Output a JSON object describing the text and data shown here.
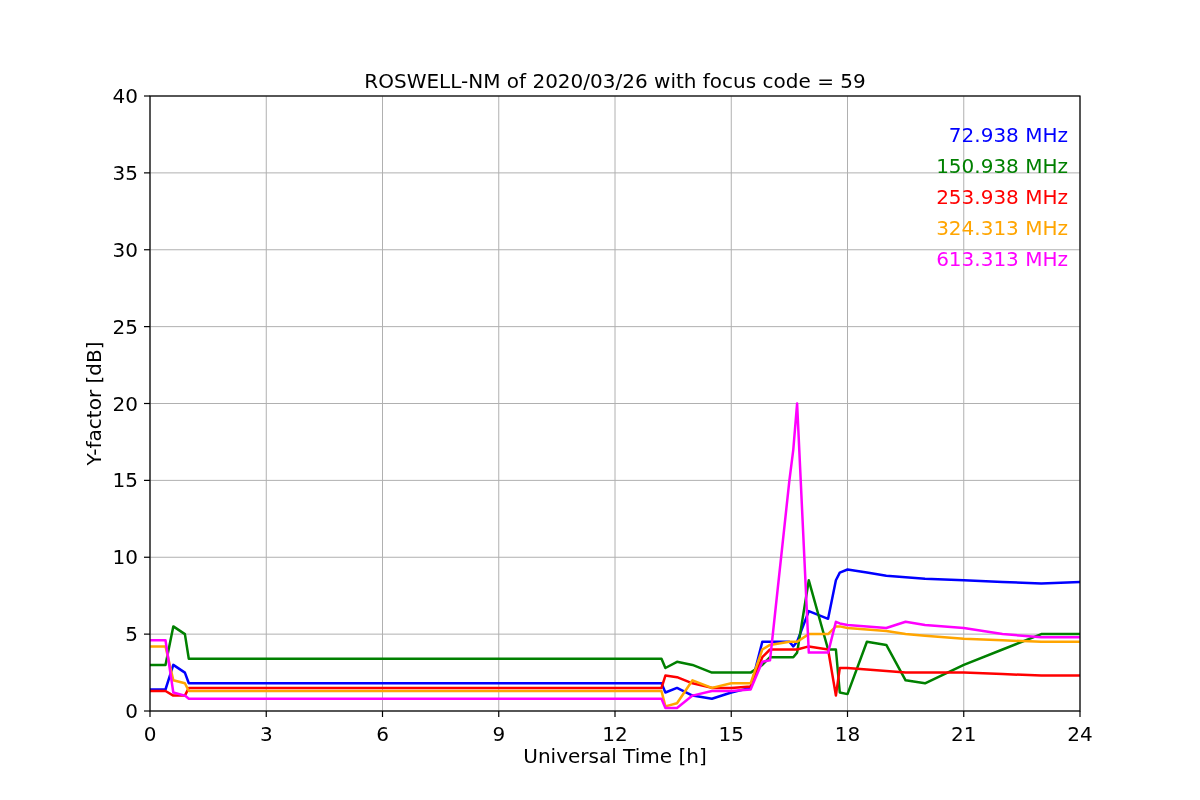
{
  "figure": {
    "chart_data": {
      "type": "line",
      "title": "ROSWELL-NM of 2020/03/26 with focus code = 59",
      "xlabel": "Universal Time [h]",
      "ylabel": "Y-factor [dB]",
      "x": [
        0,
        0.4,
        0.6,
        0.9,
        1.0,
        13.2,
        13.3,
        13.6,
        14,
        14.5,
        15,
        15.5,
        15.8,
        16,
        16.5,
        16.6,
        16.7,
        17,
        17.5,
        17.7,
        17.8,
        18,
        18.5,
        19,
        19.5,
        20,
        21,
        22,
        23,
        24
      ],
      "series": [
        {
          "name": "72.938 MHz",
          "color": "#0000ff",
          "values": [
            1.4,
            1.4,
            3.0,
            2.5,
            1.8,
            1.8,
            1.2,
            1.5,
            1.0,
            0.8,
            1.2,
            1.5,
            4.5,
            4.5,
            4.5,
            4.2,
            4.5,
            6.5,
            6.0,
            8.5,
            9.0,
            9.2,
            9.0,
            8.8,
            8.7,
            8.6,
            8.5,
            8.4,
            8.3,
            8.4
          ]
        },
        {
          "name": "150.938 MHz",
          "color": "#008000",
          "values": [
            3.0,
            3.0,
            5.5,
            5.0,
            3.4,
            3.4,
            2.8,
            3.2,
            3.0,
            2.5,
            2.5,
            2.5,
            3.0,
            3.5,
            3.5,
            3.5,
            3.8,
            8.5,
            4.0,
            4.0,
            1.2,
            1.1,
            4.5,
            4.3,
            2.0,
            1.8,
            3.0,
            4.0,
            5.0,
            5.0
          ]
        },
        {
          "name": "253.938 MHz",
          "color": "#ff0000",
          "values": [
            1.3,
            1.3,
            1.0,
            1.0,
            1.5,
            1.5,
            2.3,
            2.2,
            1.8,
            1.5,
            1.5,
            1.6,
            3.5,
            4.0,
            4.0,
            4.0,
            4.0,
            4.2,
            4.0,
            1.0,
            2.8,
            2.8,
            2.7,
            2.6,
            2.5,
            2.5,
            2.5,
            2.4,
            2.3,
            2.3
          ]
        },
        {
          "name": "324.313 MHz",
          "color": "#ffa500",
          "values": [
            4.2,
            4.2,
            2.0,
            1.8,
            1.3,
            1.3,
            0.3,
            0.5,
            2.0,
            1.5,
            1.8,
            1.8,
            4.0,
            4.3,
            4.5,
            4.5,
            4.5,
            5.0,
            5.0,
            5.5,
            5.5,
            5.4,
            5.3,
            5.2,
            5.0,
            4.9,
            4.7,
            4.6,
            4.5,
            4.5
          ]
        },
        {
          "name": "613.313 MHz",
          "color": "#ff00ff",
          "values": [
            4.6,
            4.6,
            1.2,
            1.0,
            0.8,
            0.8,
            0.2,
            0.2,
            1.0,
            1.3,
            1.3,
            1.4,
            3.2,
            3.3,
            15.0,
            17.0,
            20.0,
            3.8,
            3.8,
            5.8,
            5.7,
            5.6,
            5.5,
            5.4,
            5.8,
            5.6,
            5.4,
            5.0,
            4.8,
            4.8
          ]
        }
      ],
      "xlim": [
        0,
        24
      ],
      "ylim": [
        0,
        40
      ],
      "xticks": [
        0,
        3,
        6,
        9,
        12,
        15,
        18,
        21,
        24
      ],
      "yticks": [
        0,
        5,
        10,
        15,
        20,
        25,
        30,
        35,
        40
      ],
      "grid": true
    }
  }
}
